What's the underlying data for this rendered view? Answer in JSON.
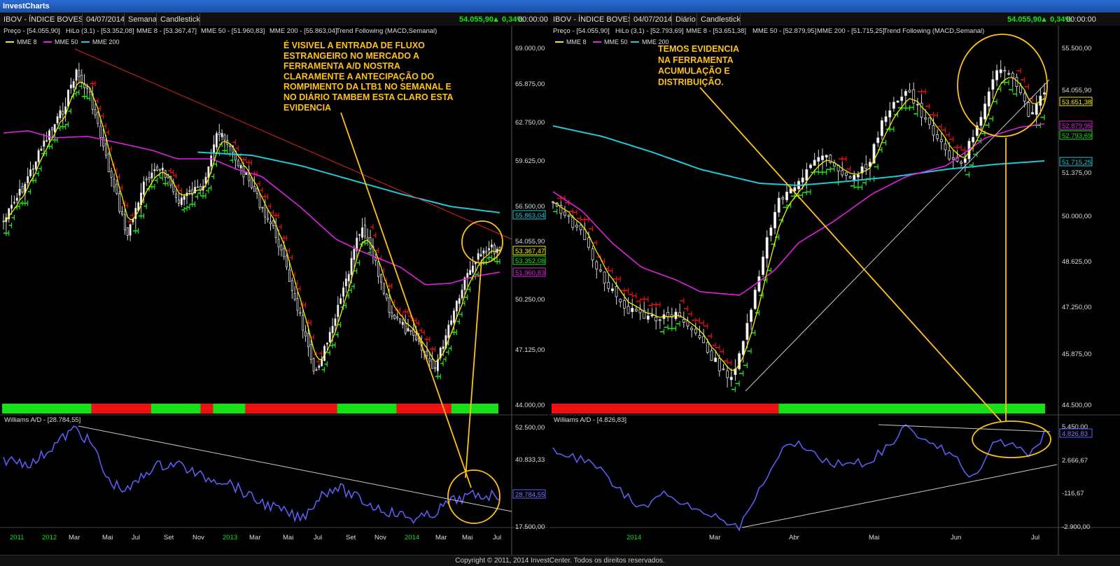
{
  "app": {
    "title": "InvestCharts"
  },
  "footer": {
    "text": "Copyright © 2011, 2014 InvestCenter. Todos os direitos reservados."
  },
  "colors": {
    "ema8": "#f0f000",
    "ema50": "#e020e0",
    "ema200": "#20c8d8",
    "ad": "#6060ff",
    "hilo_up": "#20e020",
    "hilo_down": "#e01010",
    "trend_up": "#18e018",
    "trend_down": "#f01010",
    "annotation": "#ffc21a"
  },
  "charts": [
    {
      "toolbar": {
        "symbol": "IBOV - ÍNDICE BOVESPA",
        "date": "04/07/2014",
        "period": "Semanal",
        "style": "Candlestick",
        "last": "54.055,90",
        "change": "▲ 0,34%",
        "time": "00:00:00"
      },
      "info": {
        "preco": "Preço - [54.055,90]",
        "hilo": "HiLo (3,1) - [53.352,08]",
        "mme8": "MME 8 - [53.367,47]",
        "mme50": "MME 50 - [51.960,83]",
        "mme200": "MME 200 - [55.863,04]",
        "trend": "Trend Following (MACD,Semanal)"
      },
      "legend": [
        "MME 8",
        "MME 50",
        "MME 200"
      ],
      "y_ticks": [
        "69.000,00",
        "65.875,00",
        "62.750,00",
        "59.625,00",
        "56.500,00",
        "50.250,00",
        "47.125,00",
        "44.000,00"
      ],
      "y_badges": [
        {
          "text": "55.863,04",
          "color": "#20c8d8"
        },
        {
          "text": "54.055,90",
          "color": "#dddddd"
        },
        {
          "text": "53.367,47",
          "color": "#f0f000"
        },
        {
          "text": "53.352,08",
          "color": "#20e020"
        },
        {
          "text": "51.960,83",
          "color": "#e020e0"
        }
      ],
      "annotation": [
        "É VISIVEL A ENTRADA DE FLUXO",
        "ESTRANGEIRO NO MERCADO A",
        "FERRAMENTA A/D NOSTRA",
        "CLARAMENTE A ANTECIPAÇÃO DO",
        "ROMPIMENTO DA LTB1  NO SEMANAL E",
        "NO DIÁRIO TAMBEM ESTA CLARO ESTA",
        "EVIDENCIA"
      ],
      "ad_title": "Williams A/D - [28.784,55]",
      "ad_ticks": [
        "52.500,00",
        "40.833,33",
        "17.500,00"
      ],
      "ad_badge": "28.784,55",
      "x_labels": [
        "2011",
        "2012",
        "Mar",
        "Mai",
        "Jul",
        "Set",
        "Nov",
        "2013",
        "Mar",
        "Mai",
        "Jul",
        "Set",
        "Nov",
        "2014",
        "Mar",
        "Mai",
        "Jul"
      ],
      "trend_segments": [
        {
          "state": "up",
          "from": 0,
          "to": 0.18
        },
        {
          "state": "down",
          "from": 0.18,
          "to": 0.3
        },
        {
          "state": "up",
          "from": 0.3,
          "to": 0.4
        },
        {
          "state": "down",
          "from": 0.4,
          "to": 0.425
        },
        {
          "state": "up",
          "from": 0.425,
          "to": 0.49
        },
        {
          "state": "down",
          "from": 0.49,
          "to": 0.675
        },
        {
          "state": "up",
          "from": 0.675,
          "to": 0.795
        },
        {
          "state": "down",
          "from": 0.795,
          "to": 0.905
        },
        {
          "state": "up",
          "from": 0.905,
          "to": 1
        }
      ]
    },
    {
      "toolbar": {
        "symbol": "IBOV - ÍNDICE BOVESPA",
        "date": "04/07/2014",
        "period": "Diário",
        "style": "Candlestick",
        "last": "54.055,90",
        "change": "▲ 0,34%",
        "time": "00:00:00"
      },
      "info": {
        "preco": "Preço - [54.055,90]",
        "hilo": "HiLo (3,1) - [52.793,69]",
        "mme8": "MME 8 - [53.651,38]",
        "mme50": "MME 50 - [52.879,95]",
        "mme200": "MME 200 - [51.715,25]",
        "trend": "Trend Following (MACD,Semanal)"
      },
      "legend": [
        "MME 8",
        "MME 50",
        "MME 200"
      ],
      "y_ticks": [
        "55.500,00",
        "51.375,00",
        "50.000,00",
        "48.625,00",
        "47.250,00",
        "45.875,00",
        "44.500,00"
      ],
      "y_badges": [
        {
          "text": "54.055,90",
          "color": "#dddddd"
        },
        {
          "text": "53.651,38",
          "color": "#f0f000"
        },
        {
          "text": "52.879,95",
          "color": "#e020e0"
        },
        {
          "text": "52.793,69",
          "color": "#20e020"
        },
        {
          "text": "51.715,25",
          "color": "#20c8d8"
        }
      ],
      "annotation": [
        "TEMOS EVIDENCIA",
        "NA FERRAMENTA",
        "ACUMULAÇÃO E",
        "DISTRIBUIÇÃO."
      ],
      "ad_title": "Williams A/D - [4.826,83]",
      "ad_ticks": [
        "5.450,00",
        "2.666,67",
        "-116,67",
        "-2.900,00"
      ],
      "ad_badge": "4.826,83",
      "x_labels": [
        "2014",
        "Mar",
        "Abr",
        "Mai",
        "Jun",
        "Jul"
      ],
      "trend_segments": [
        {
          "state": "down",
          "from": 0,
          "to": 0.46
        },
        {
          "state": "up",
          "from": 0.46,
          "to": 1
        }
      ]
    }
  ]
}
